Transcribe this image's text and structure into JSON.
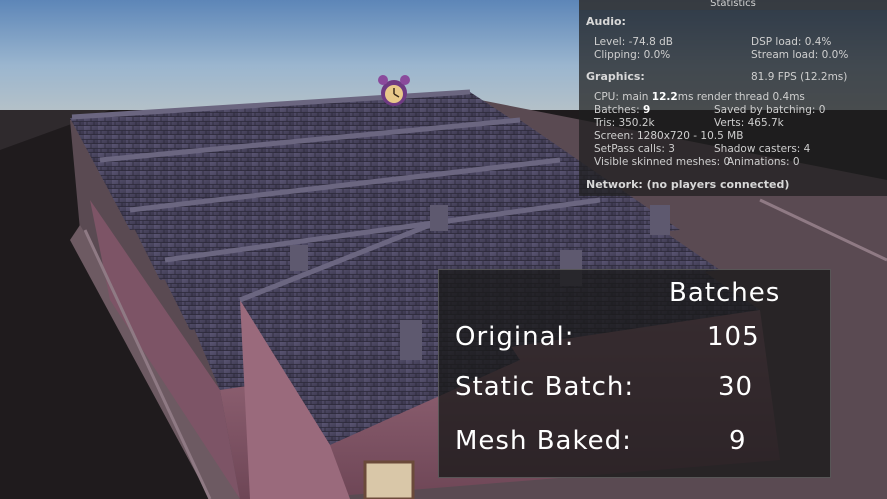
{
  "stats": {
    "title": "Statistics",
    "audio_header": "Audio:",
    "level": "Level: -74.8 dB",
    "dsp_load": "DSP load: 0.4%",
    "clipping": "Clipping: 0.0%",
    "stream_load": "Stream load: 0.0%",
    "graphics_header": "Graphics:",
    "fps": "81.9 FPS (12.2ms)",
    "cpu_prefix": "CPU: main ",
    "cpu_main": "12.2",
    "cpu_suffix": "ms  render thread 0.4ms",
    "batches_prefix": "Batches: ",
    "batches_value": "9",
    "saved_by_batching": "Saved by batching: 0",
    "tris": "Tris: 350.2k",
    "verts": "Verts: 465.7k",
    "screen": "Screen: 1280x720 - 10.5 MB",
    "setpass": "SetPass calls: 3",
    "shadow_casters": "Shadow casters: 4",
    "visible_skinned": "Visible skinned meshes: 0",
    "animations": "Animations: 0",
    "network": "Network: (no players connected)"
  },
  "batch_panel": {
    "header": "Batches",
    "rows": [
      {
        "label": "Original:",
        "value": "105"
      },
      {
        "label": "Static Batch:",
        "value": "30"
      },
      {
        "label": "Mesh Baked:",
        "value": "9"
      }
    ]
  },
  "scene": {
    "sky_color": "#7da3c9",
    "roof_color": "#4a4660",
    "wall_color": "#8a5a6e",
    "ground_color": "#3b2f33",
    "clock_color": "#7a3d8a"
  }
}
